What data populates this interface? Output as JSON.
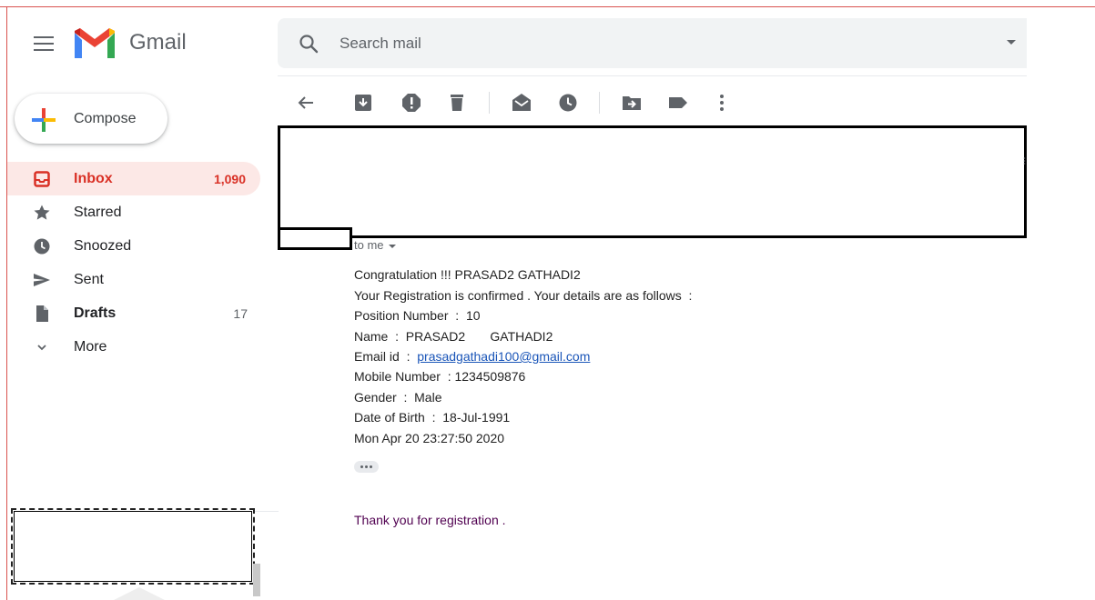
{
  "app": {
    "name": "Gmail"
  },
  "search": {
    "placeholder": "Search mail"
  },
  "compose": {
    "label": "Compose"
  },
  "nav": [
    {
      "label": "Inbox",
      "count": "1,090",
      "icon": "inbox-icon",
      "active": true
    },
    {
      "label": "Starred",
      "count": "",
      "icon": "star-icon"
    },
    {
      "label": "Snoozed",
      "count": "",
      "icon": "clock-icon"
    },
    {
      "label": "Sent",
      "count": "",
      "icon": "send-icon"
    },
    {
      "label": "Drafts",
      "count": "17",
      "icon": "draft-icon"
    },
    {
      "label": "More",
      "count": "",
      "icon": "chevron-down-icon"
    }
  ],
  "toolbar": [
    "back-arrow-icon",
    "archive-icon",
    "report-spam-icon",
    "delete-icon",
    "mark-unread-icon",
    "snooze-icon",
    "move-to-icon",
    "label-icon",
    "more-vert-icon"
  ],
  "message": {
    "recipient": "to me",
    "lines": {
      "congrats": "Congratulation !!! PRASAD2 GATHADI2",
      "confirmed": "Your Registration is confirmed . Your details are as follows  :",
      "position": "Position Number  :  10",
      "name": "Name  :  PRASAD2       GATHADI2",
      "email_label": "Email id  :  ",
      "email_value": "prasadgathadi100@gmail.com",
      "mobile": "Mobile Number  : 1234509876",
      "gender": "Gender  :  Male",
      "dob": "Date of Birth  :  18-Jul-1991",
      "date": "Mon Apr 20 23:27:50 2020"
    },
    "thanks": "Thank you for registration ."
  },
  "colors": {
    "accent_red": "#d93025",
    "active_bg": "#fce8e6",
    "link": "#1a55b8",
    "thanks_text": "#500050"
  }
}
